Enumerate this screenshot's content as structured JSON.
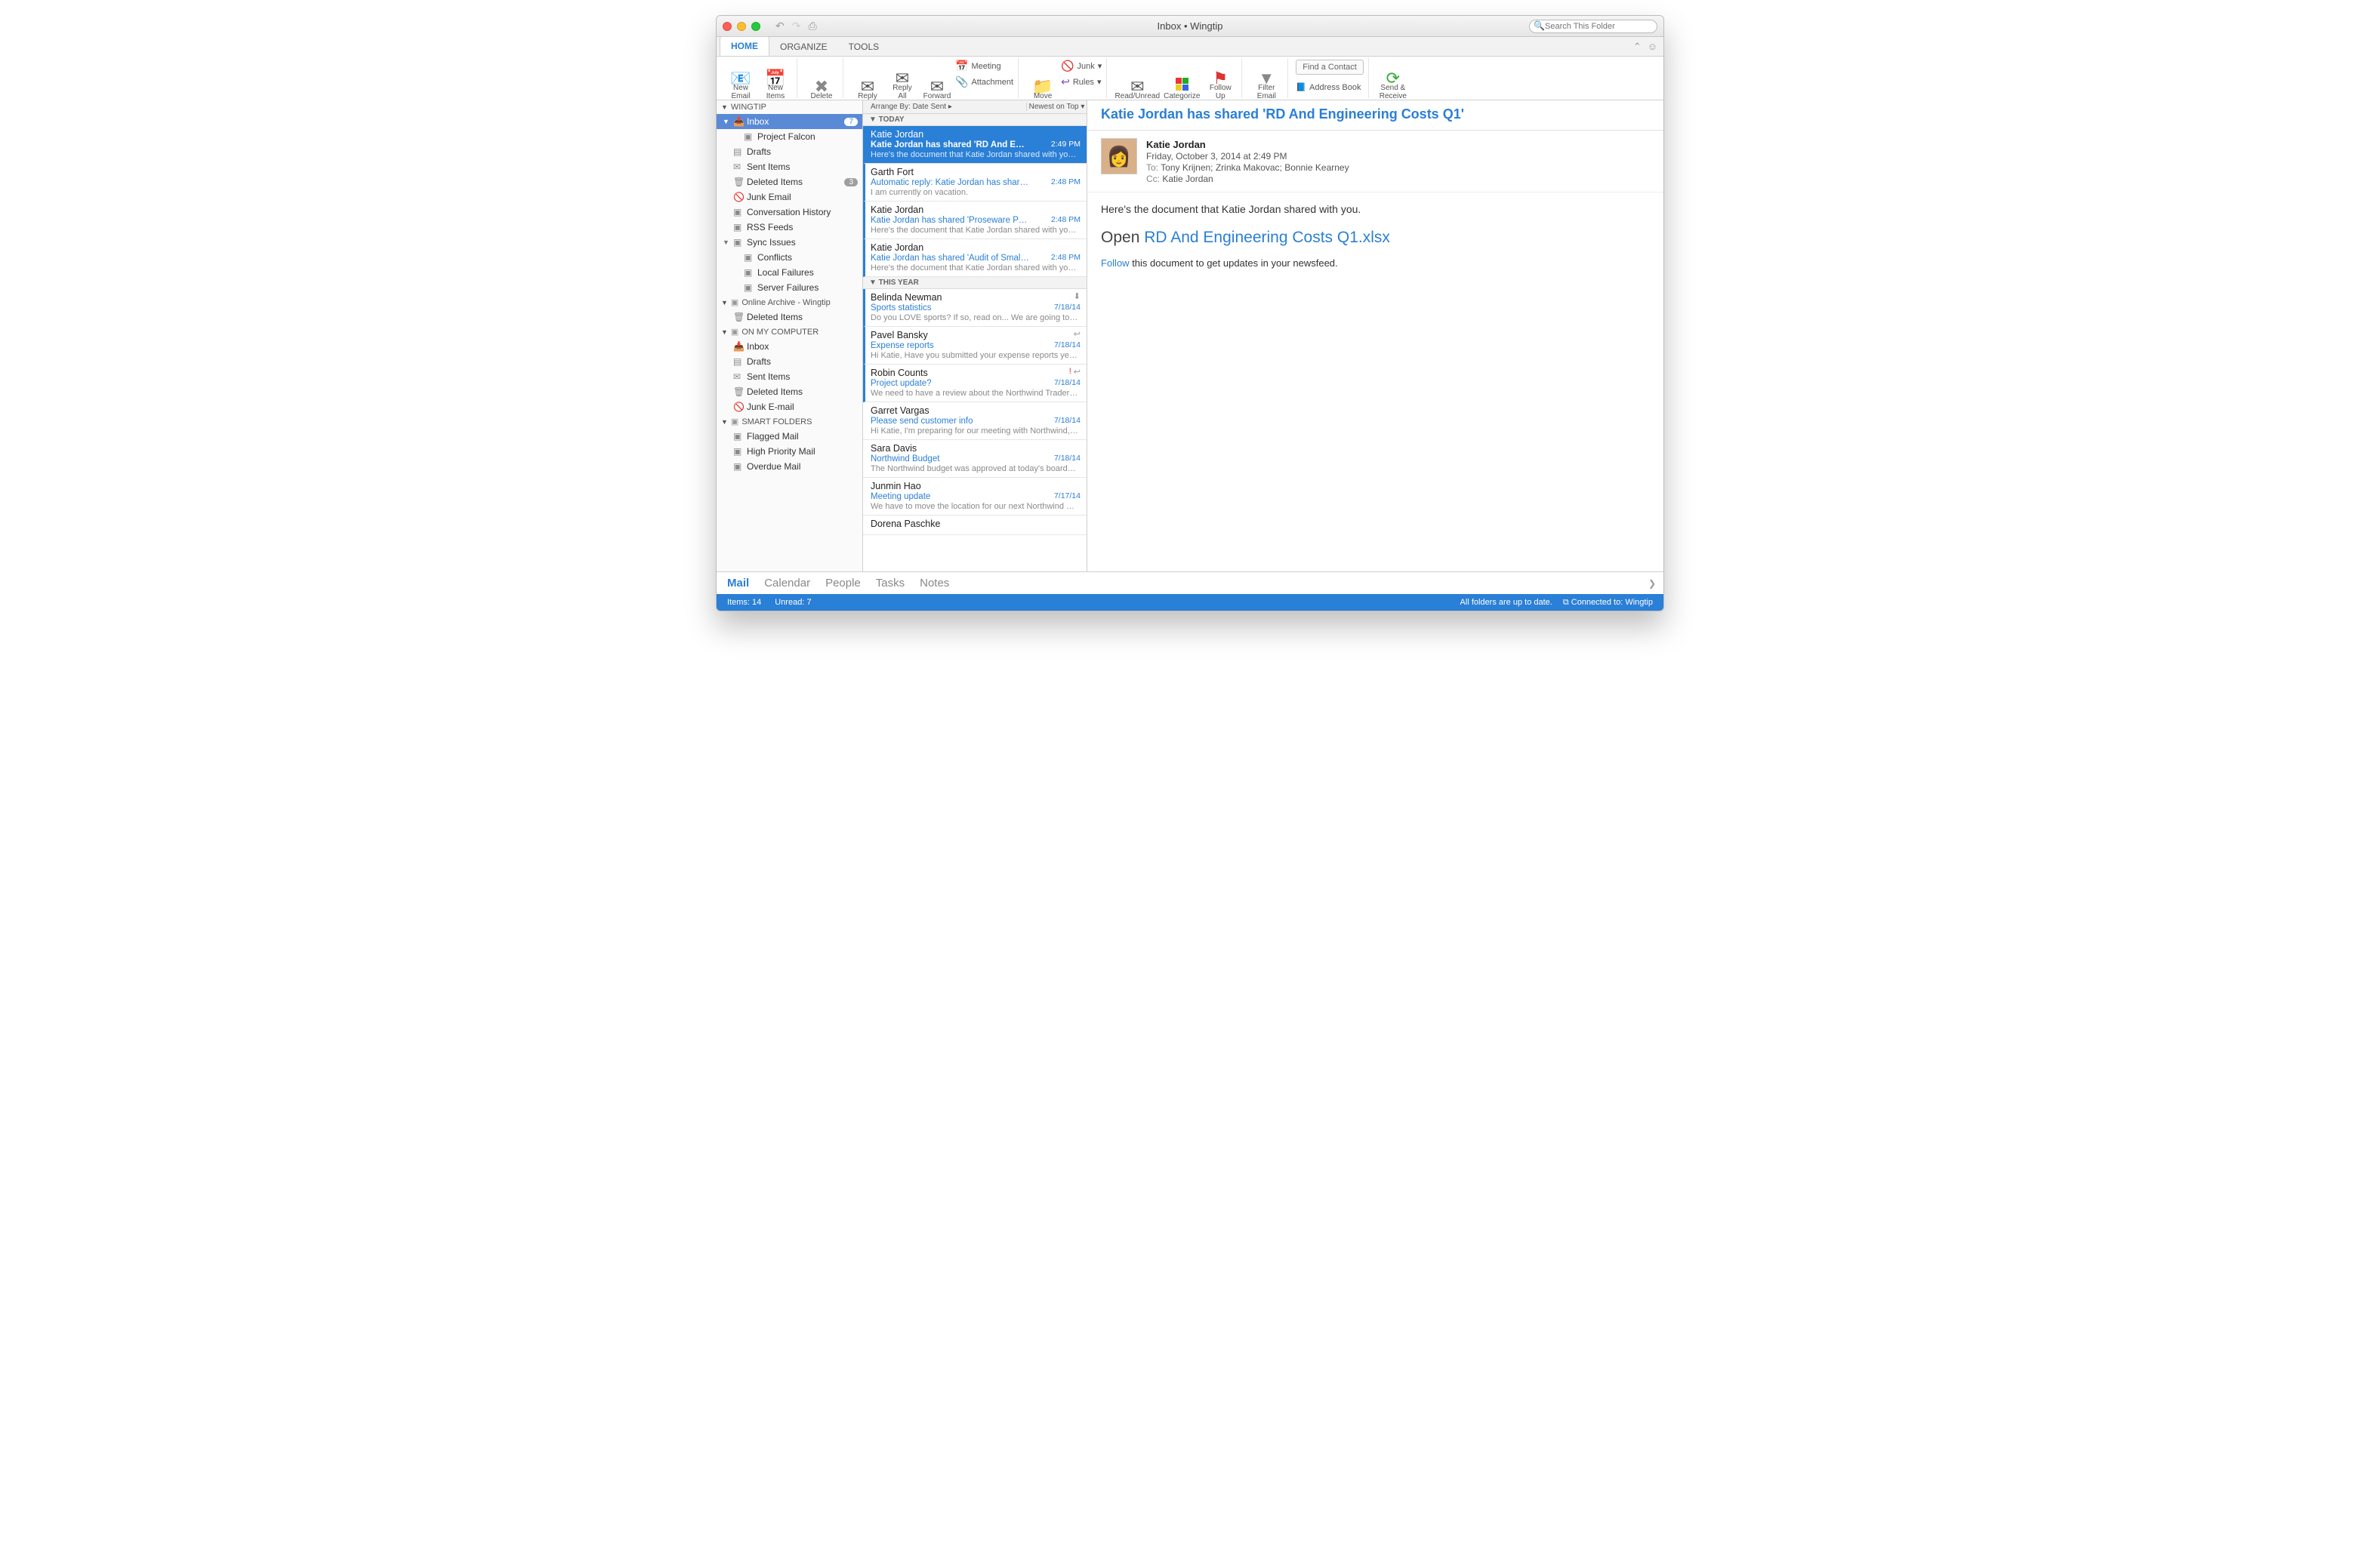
{
  "titlebar": {
    "title": "Inbox • Wingtip"
  },
  "search": {
    "placeholder": "Search This Folder"
  },
  "tabs": [
    "HOME",
    "ORGANIZE",
    "TOOLS"
  ],
  "ribbon": {
    "new_email": "New\nEmail",
    "new_items": "New\nItems",
    "delete": "Delete",
    "reply": "Reply",
    "reply_all": "Reply\nAll",
    "forward": "Forward",
    "meeting": "Meeting",
    "attachment": "Attachment",
    "move": "Move",
    "junk": "Junk",
    "rules": "Rules",
    "read_unread": "Read/Unread",
    "categorize": "Categorize",
    "follow_up": "Follow\nUp",
    "filter_email": "Filter\nEmail",
    "find_contact": "Find a Contact",
    "address_book": "Address Book",
    "send_receive": "Send &\nReceive"
  },
  "sidebar": {
    "sections": [
      {
        "label": "WINGTIP",
        "items": [
          {
            "label": "Inbox",
            "icon": "inbox",
            "selected": true,
            "badge": "7",
            "lvl": 1,
            "expandable": true
          },
          {
            "label": "Project Falcon",
            "icon": "folder",
            "lvl": 2
          },
          {
            "label": "Drafts",
            "icon": "drafts",
            "lvl": 1
          },
          {
            "label": "Sent Items",
            "icon": "sent",
            "lvl": 1
          },
          {
            "label": "Deleted Items",
            "icon": "trash",
            "lvl": 1,
            "badge": "3"
          },
          {
            "label": "Junk Email",
            "icon": "junk",
            "lvl": 1
          },
          {
            "label": "Conversation History",
            "icon": "folder",
            "lvl": 1
          },
          {
            "label": "RSS Feeds",
            "icon": "folder",
            "lvl": 1
          },
          {
            "label": "Sync Issues",
            "icon": "folder",
            "lvl": 1,
            "expandable": true
          },
          {
            "label": "Conflicts",
            "icon": "folder",
            "lvl": 2
          },
          {
            "label": "Local Failures",
            "icon": "folder",
            "lvl": 2
          },
          {
            "label": "Server Failures",
            "icon": "folder",
            "lvl": 2
          }
        ]
      },
      {
        "label": "Online Archive - Wingtip",
        "items": [
          {
            "label": "Deleted Items",
            "icon": "trash",
            "lvl": 1
          }
        ]
      },
      {
        "label": "ON MY COMPUTER",
        "items": [
          {
            "label": "Inbox",
            "icon": "inbox",
            "lvl": 1
          },
          {
            "label": "Drafts",
            "icon": "drafts",
            "lvl": 1
          },
          {
            "label": "Sent Items",
            "icon": "sent",
            "lvl": 1
          },
          {
            "label": "Deleted Items",
            "icon": "trash",
            "lvl": 1
          },
          {
            "label": "Junk E-mail",
            "icon": "junk",
            "lvl": 1
          }
        ]
      },
      {
        "label": "SMART FOLDERS",
        "items": [
          {
            "label": "Flagged Mail",
            "icon": "folder",
            "lvl": 1
          },
          {
            "label": "High Priority Mail",
            "icon": "folder",
            "lvl": 1
          },
          {
            "label": "Overdue Mail",
            "icon": "folder",
            "lvl": 1
          }
        ]
      }
    ]
  },
  "msglist": {
    "arrange_label": "Arrange By: Date Sent  ▸",
    "sort_label": "Newest on Top ▾",
    "groups": [
      {
        "label": "TODAY",
        "msgs": [
          {
            "from": "Katie Jordan",
            "subj": "Katie Jordan has shared 'RD And Engineeri…",
            "prev": "Here's the document that Katie Jordan shared with you…",
            "time": "2:49 PM",
            "unread": true,
            "selected": true
          },
          {
            "from": "Garth Fort",
            "subj": "Automatic reply: Katie Jordan has shared '…",
            "prev": "I am currently on vacation.",
            "time": "2:48 PM",
            "unread": true
          },
          {
            "from": "Katie Jordan",
            "subj": "Katie Jordan has shared 'Proseware Projec…",
            "prev": "Here's the document that Katie Jordan shared with you…",
            "time": "2:48 PM",
            "unread": true
          },
          {
            "from": "Katie Jordan",
            "subj": "Katie Jordan has shared 'Audit of Small Bu…",
            "prev": "Here's the document that Katie Jordan shared with you…",
            "time": "2:48 PM",
            "unread": true
          }
        ]
      },
      {
        "label": "THIS YEAR",
        "msgs": [
          {
            "from": "Belinda Newman",
            "subj": "Sports statistics",
            "prev": "Do you LOVE sports? If so, read on... We are going to…",
            "time": "7/18/14",
            "unread": true,
            "flag_down": true
          },
          {
            "from": "Pavel Bansky",
            "subj": "Expense reports",
            "prev": "Hi Katie, Have you submitted your expense reports yet…",
            "time": "7/18/14",
            "unread": true,
            "reply": true
          },
          {
            "from": "Robin Counts",
            "subj": "Project update?",
            "prev": "We need to have a review about the Northwind Traders…",
            "time": "7/18/14",
            "unread": true,
            "imp": true,
            "reply": true
          },
          {
            "from": "Garret Vargas",
            "subj": "Please send customer info",
            "prev": "Hi Katie, I'm preparing for our meeting with Northwind,…",
            "time": "7/18/14"
          },
          {
            "from": "Sara Davis",
            "subj": "Northwind Budget",
            "prev": "The Northwind budget was approved at today's board…",
            "time": "7/18/14"
          },
          {
            "from": "Junmin Hao",
            "subj": "Meeting update",
            "prev": "We have to move the location for our next Northwind Tr…",
            "time": "7/17/14"
          },
          {
            "from": "Dorena Paschke",
            "subj": "",
            "prev": "",
            "time": ""
          }
        ]
      }
    ]
  },
  "reading": {
    "subject": "Katie Jordan has shared 'RD And Engineering Costs Q1'",
    "from": "Katie Jordan",
    "date": "Friday, October 3, 2014 at 2:49 PM",
    "to_label": "To:",
    "to": "Tony Krijnen;   Zrinka Makovac;   Bonnie Kearney",
    "cc_label": "Cc:",
    "cc": "Katie Jordan",
    "body_intro": "Here's the document that Katie Jordan shared with you.",
    "open_label": "Open",
    "open_link": "RD And Engineering Costs Q1.xlsx",
    "follow_link": "Follow",
    "follow_rest": " this document to get updates in your newsfeed."
  },
  "nav": [
    "Mail",
    "Calendar",
    "People",
    "Tasks",
    "Notes"
  ],
  "status": {
    "items": "Items: 14",
    "unread": "Unread: 7",
    "sync": "All folders are up to date.",
    "conn": "Connected to: Wingtip"
  }
}
